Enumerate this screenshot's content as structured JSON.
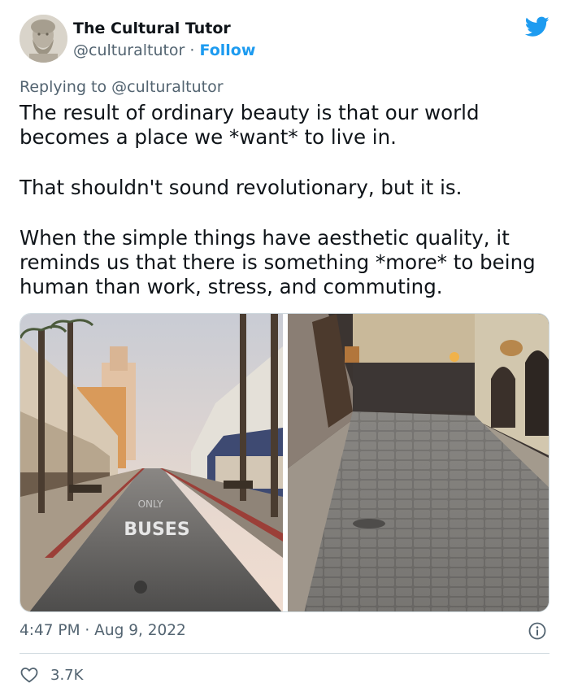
{
  "tweet": {
    "author_name": "The Cultural Tutor",
    "author_handle": "@culturaltutor",
    "separator": "·",
    "follow_label": "Follow",
    "reply_prefix": "Replying to",
    "reply_handle": "@culturaltutor",
    "paragraphs": [
      "The result of ordinary beauty is that our world becomes a place we *want* to live in.",
      "That shouldn't sound revolutionary, but it is.",
      "When the simple things have aesthetic quality, it reminds us that there is something *more* to being human than work, stress, and commuting."
    ],
    "media": {
      "left_photo_street_text": "BUSES"
    },
    "timestamp": "4:47 PM · Aug 9, 2022",
    "likes": "3.7K"
  },
  "icons": {
    "brand": "twitter-bird-icon",
    "info": "info-icon",
    "like": "heart-icon"
  },
  "colors": {
    "accent": "#1d9bf0",
    "secondary_text": "#536471",
    "primary_text": "#0f1419",
    "border": "#cfd9de"
  }
}
